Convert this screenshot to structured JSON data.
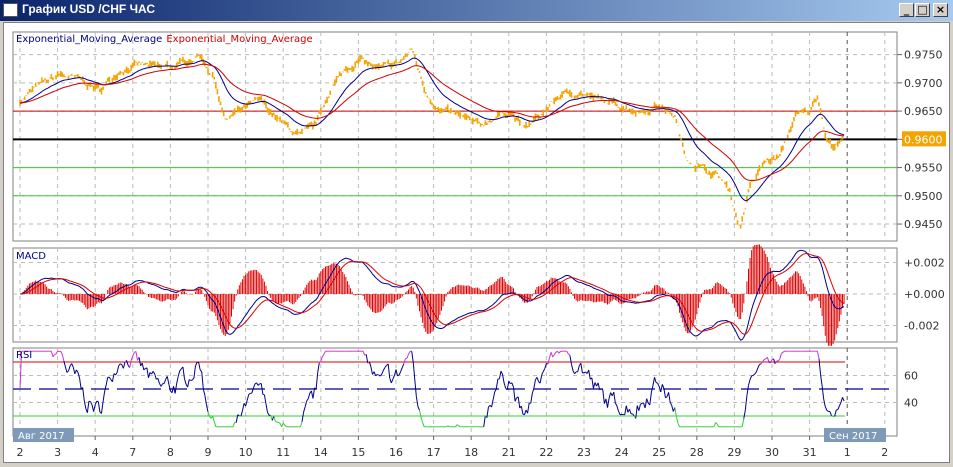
{
  "window": {
    "title": "График USD /CHF  ЧАС",
    "buttons": [
      "_",
      "□",
      "×"
    ]
  },
  "main_panel": {
    "legend": [
      {
        "label": "Exponential_Moving_Average",
        "color": "#00008b"
      },
      {
        "label": "Exponential_Moving_Average",
        "color": "#cc0000"
      }
    ],
    "y_ticks": [
      "0.9750",
      "0.9700",
      "0.9650",
      "0.9600",
      "0.9550",
      "0.9500",
      "0.9450"
    ],
    "y_range": [
      0.942,
      0.979
    ],
    "current_price": "0.9600",
    "levels": [
      {
        "value": 0.965,
        "color": "#cc0000"
      },
      {
        "value": 0.96,
        "color": "#000000"
      },
      {
        "value": 0.955,
        "color": "#33cc33"
      },
      {
        "value": 0.95,
        "color": "#33cc33"
      }
    ],
    "price_color": "#f5a300",
    "series_t_days_price": [
      [
        0,
        0.9669
      ],
      [
        0.53,
        0.9696
      ],
      [
        1.06,
        0.9714
      ],
      [
        1.6,
        0.9705
      ],
      [
        2.13,
        0.9687
      ],
      [
        2.66,
        0.9723
      ],
      [
        3.19,
        0.9732
      ],
      [
        3.72,
        0.9726
      ],
      [
        4.26,
        0.9732
      ],
      [
        4.79,
        0.975
      ],
      [
        5.19,
        0.9705
      ],
      [
        5.45,
        0.9632
      ],
      [
        5.85,
        0.965
      ],
      [
        6.38,
        0.9669
      ],
      [
        6.91,
        0.9632
      ],
      [
        7.45,
        0.9605
      ],
      [
        7.85,
        0.9623
      ],
      [
        8.24,
        0.9687
      ],
      [
        8.64,
        0.9723
      ],
      [
        9.04,
        0.9741
      ],
      [
        9.57,
        0.9723
      ],
      [
        10.11,
        0.9737
      ],
      [
        10.43,
        0.9759
      ],
      [
        10.77,
        0.9687
      ],
      [
        11.17,
        0.965
      ],
      [
        11.7,
        0.9641
      ],
      [
        12.23,
        0.9623
      ],
      [
        12.63,
        0.9641
      ],
      [
        13.03,
        0.965
      ],
      [
        13.43,
        0.9618
      ],
      [
        13.83,
        0.9641
      ],
      [
        14.36,
        0.9678
      ],
      [
        14.89,
        0.9683
      ],
      [
        15.43,
        0.9669
      ],
      [
        15.96,
        0.966
      ],
      [
        16.49,
        0.965
      ],
      [
        17.02,
        0.966
      ],
      [
        17.42,
        0.9641
      ],
      [
        17.69,
        0.9569
      ],
      [
        18.09,
        0.9551
      ],
      [
        18.62,
        0.9533
      ],
      [
        18.88,
        0.9506
      ],
      [
        19.15,
        0.9443
      ],
      [
        19.41,
        0.9515
      ],
      [
        19.81,
        0.956
      ],
      [
        20.21,
        0.9569
      ],
      [
        20.61,
        0.9641
      ],
      [
        21.01,
        0.965
      ],
      [
        21.22,
        0.9678
      ],
      [
        21.41,
        0.9614
      ],
      [
        21.6,
        0.9587
      ],
      [
        21.94,
        0.96
      ]
    ]
  },
  "macd_panel": {
    "label": "MACD",
    "y_ticks": [
      "+0.002",
      "+0.000",
      "-0.002"
    ],
    "y_values": [
      0.002,
      0,
      -0.002
    ]
  },
  "rsi_panel": {
    "label": "RSI",
    "y_ticks": [
      "60",
      "40"
    ],
    "y_values": [
      60,
      40
    ],
    "overbought": 70,
    "oversold": 30,
    "mid": 50
  },
  "x_axis": {
    "start_label": "Авг 2017",
    "end_label": "Сен 2017",
    "days": [
      "2",
      "3",
      "4",
      "7",
      "8",
      "9",
      "10",
      "11",
      "14",
      "15",
      "16",
      "17",
      "18",
      "21",
      "22",
      "23",
      "24",
      "25",
      "28",
      "29",
      "30",
      "31",
      "1",
      "2"
    ]
  }
}
